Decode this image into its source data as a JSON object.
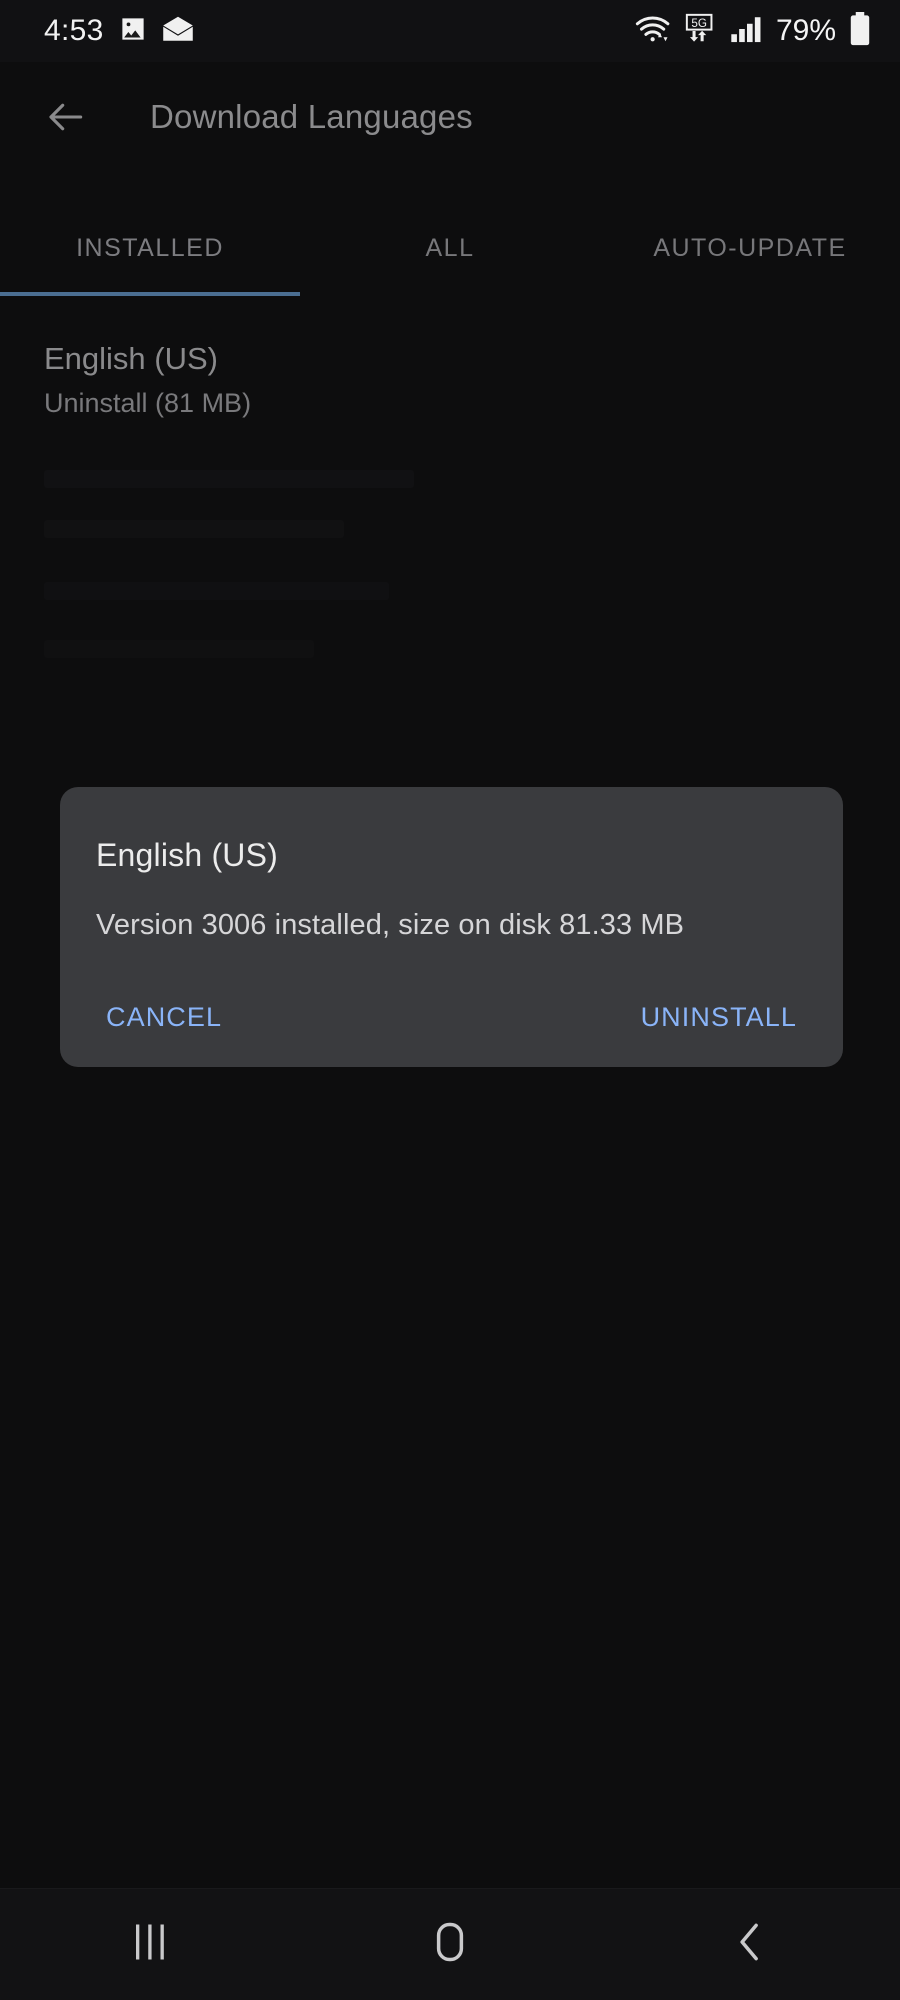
{
  "status_bar": {
    "time": "4:53",
    "icons_left": [
      "image-icon",
      "mail-icon"
    ],
    "wifi_icon": "wifi-icon",
    "network_badge": "5G",
    "signal_icon": "cellular-signal-icon",
    "battery_percent": "79%",
    "battery_icon": "battery-icon"
  },
  "app_bar": {
    "back_icon": "back-arrow-icon",
    "title": "Download Languages"
  },
  "tabs": {
    "items": [
      {
        "label": "INSTALLED",
        "active": true
      },
      {
        "label": "ALL",
        "active": false
      },
      {
        "label": "AUTO-UPDATE",
        "active": false
      }
    ],
    "indicator_color": "#4b6e92"
  },
  "language_list": {
    "items": [
      {
        "title": "English (US)",
        "subtitle": "Uninstall (81 MB)"
      }
    ]
  },
  "dialog": {
    "title": "English (US)",
    "message": "Version 3006 installed, size on disk 81.33 MB",
    "cancel_label": "CANCEL",
    "confirm_label": "UNINSTALL",
    "accent_color": "#8ab4f8",
    "surface_color": "#3a3b3e"
  },
  "nav_bar": {
    "recents_icon": "recents-icon",
    "home_icon": "home-icon",
    "back_icon": "nav-back-icon"
  }
}
